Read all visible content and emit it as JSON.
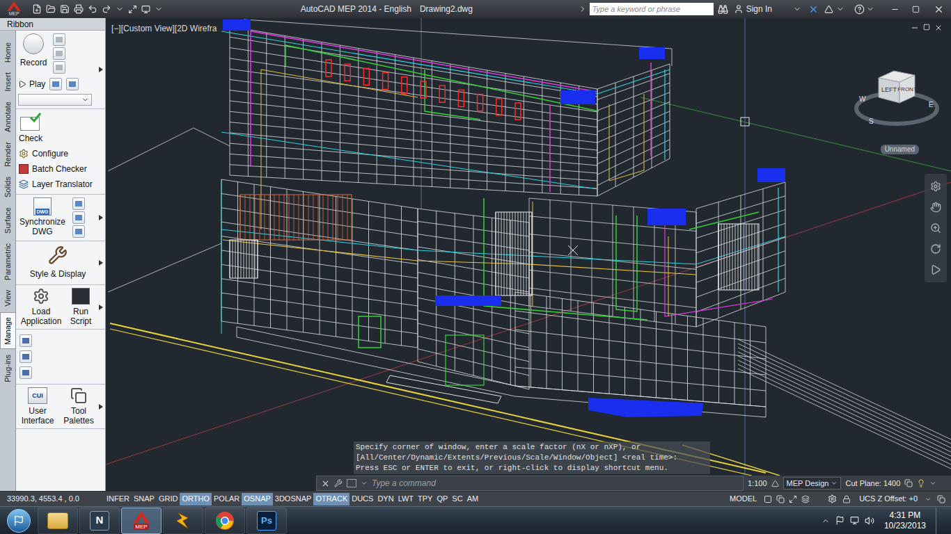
{
  "window": {
    "app_badge": "MEP",
    "title": "AutoCAD MEP 2014 - English",
    "file": "Drawing2.dwg"
  },
  "search": {
    "placeholder": "Type a keyword or phrase"
  },
  "account": {
    "label": "Sign In"
  },
  "ribbon": {
    "title": "Ribbon",
    "tabs": [
      {
        "label": "Home",
        "selected": false
      },
      {
        "label": "Insert",
        "selected": false
      },
      {
        "label": "Annotate",
        "selected": false
      },
      {
        "label": "Render",
        "selected": false
      },
      {
        "label": "Solids",
        "selected": false
      },
      {
        "label": "Surface",
        "selected": false
      },
      {
        "label": "Parametric",
        "selected": false
      },
      {
        "label": "View",
        "selected": false
      },
      {
        "label": "Manage",
        "selected": true
      },
      {
        "label": "Plug-ins",
        "selected": false
      }
    ],
    "record": "Record",
    "play": "Play",
    "check": "Check",
    "configure": "Configure",
    "batch_checker": "Batch Checker",
    "layer_translator": "Layer Translator",
    "synchronize": "Synchronize DWG",
    "dwg_badge": "DWG",
    "style_display": "Style & Display",
    "load_application": "Load Application",
    "run_script": "Run Script",
    "user_interface": "User Interface",
    "cui_badge": "CUI",
    "tool_palettes": "Tool Palettes"
  },
  "viewport": {
    "label": "[−][Custom View][2D Wirefra",
    "ucs": "Unnamed"
  },
  "viewcube": {
    "left_face": "LEFT",
    "right_face": "FRONT",
    "compass": [
      "W",
      "S",
      "E"
    ]
  },
  "command": {
    "history": [
      "Specify corner of window, enter a scale factor (nX or nXP), or",
      "[All/Center/Dynamic/Extents/Previous/Scale/Window/Object] <real time>:",
      "Press ESC or ENTER to exit, or right-click to display shortcut menu."
    ],
    "placeholder": "Type a command",
    "scale": "1:100",
    "workspace": "MEP Design",
    "cut_plane": "Cut Plane: 1400"
  },
  "status": {
    "coords": "33990.3, 4553.4 , 0.0",
    "toggles": [
      {
        "label": "INFER",
        "on": false
      },
      {
        "label": "SNAP",
        "on": false
      },
      {
        "label": "GRID",
        "on": false
      },
      {
        "label": "ORTHO",
        "on": true
      },
      {
        "label": "POLAR",
        "on": false
      },
      {
        "label": "OSNAP",
        "on": true
      },
      {
        "label": "3DOSNAP",
        "on": false
      },
      {
        "label": "OTRACK",
        "on": true
      },
      {
        "label": "DUCS",
        "on": false
      },
      {
        "label": "DYN",
        "on": false
      },
      {
        "label": "LWT",
        "on": false
      },
      {
        "label": "TPY",
        "on": false
      },
      {
        "label": "QP",
        "on": false
      },
      {
        "label": "SC",
        "on": false
      },
      {
        "label": "AM",
        "on": false
      }
    ],
    "model": "MODEL",
    "ucs_offset": "UCS Z Offset: +0"
  },
  "taskbar": {
    "apps": [
      {
        "kind": "explorer",
        "selected": false
      },
      {
        "kind": "navisworks",
        "label": "N",
        "selected": false
      },
      {
        "kind": "autocad",
        "label": "MEP",
        "selected": true
      },
      {
        "kind": "winamp",
        "selected": false
      },
      {
        "kind": "chrome",
        "selected": false
      },
      {
        "kind": "photoshop",
        "label": "Ps",
        "selected": false
      }
    ],
    "time": "4:31 PM",
    "date": "10/23/2013"
  }
}
